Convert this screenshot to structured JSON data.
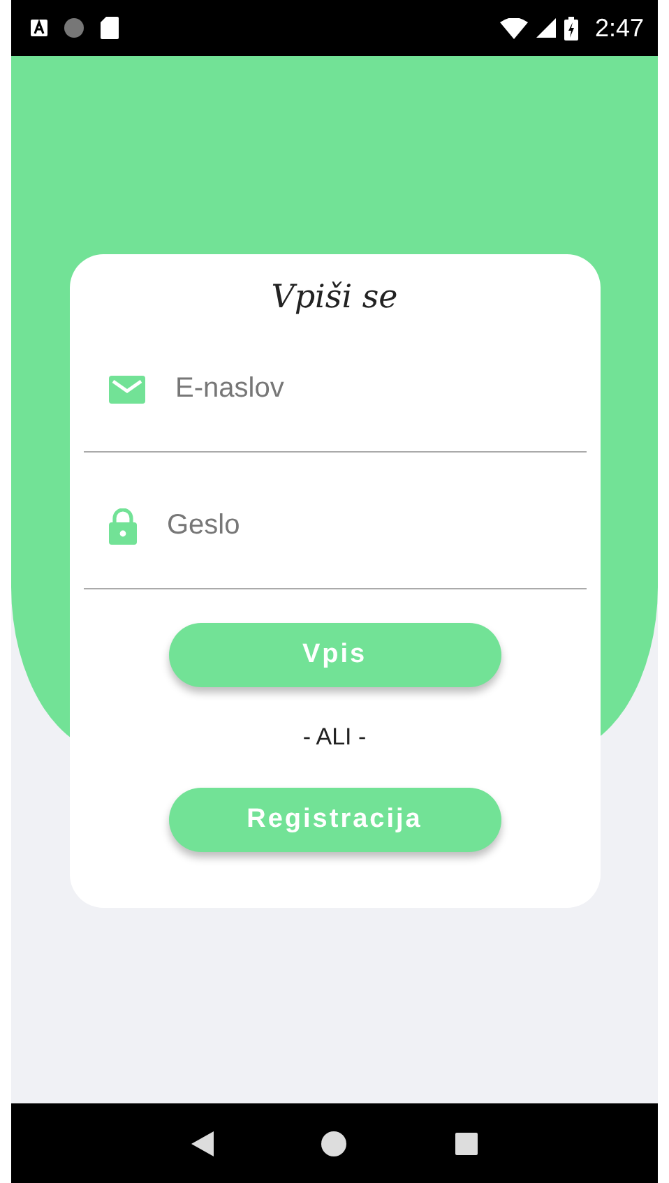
{
  "status_bar": {
    "time": "2:47"
  },
  "login_card": {
    "title": "Vpiši se",
    "fields": [
      {
        "kind": "email",
        "placeholder": "E-naslov"
      },
      {
        "kind": "password",
        "placeholder": "Geslo"
      }
    ],
    "login_button": "Vpis",
    "divider_text": "- ALI -",
    "register_button": "Registracija"
  }
}
